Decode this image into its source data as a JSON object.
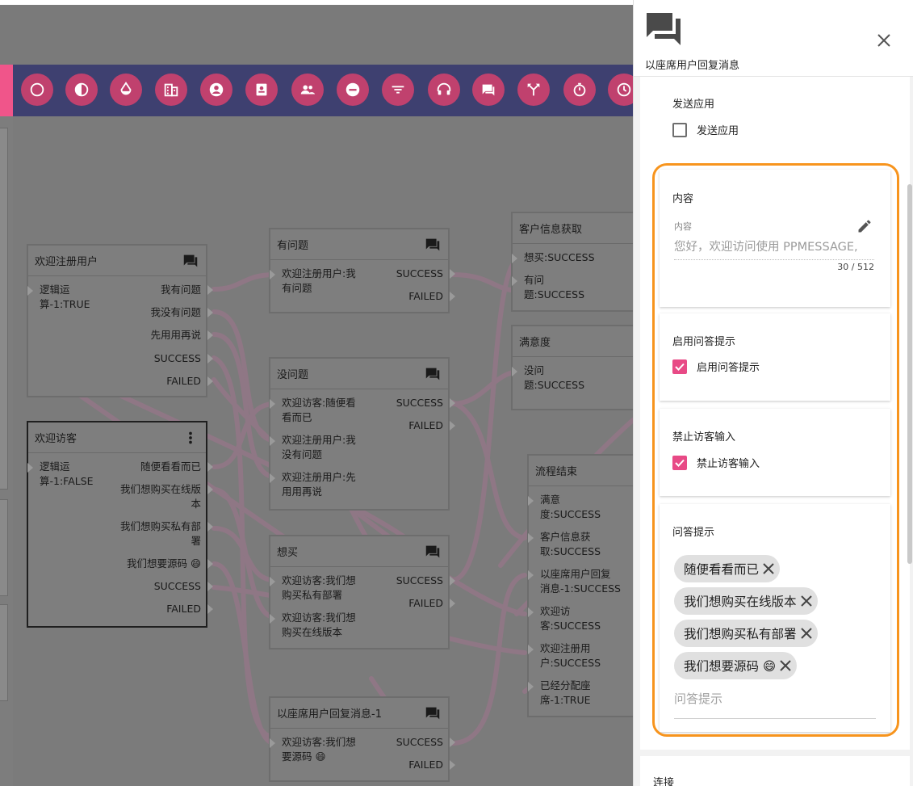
{
  "toolbar": {
    "icons": [
      "circle-icon",
      "contrast-icon",
      "drop-icon",
      "building-icon",
      "account-icon",
      "contacts-icon",
      "group-icon",
      "minus-circle-icon",
      "filter-icon",
      "headset-icon",
      "chat-icon",
      "split-icon",
      "timer-icon",
      "clock-icon"
    ]
  },
  "nodes": {
    "welcome_registered": {
      "title": "欢迎注册用户",
      "input": "逻辑运\n算-1:TRUE",
      "outputs": [
        "我有问题",
        "我没有问题",
        "先用用再说",
        "SUCCESS",
        "FAILED"
      ]
    },
    "welcome_visitor": {
      "title": "欢迎访客",
      "input": "逻辑运\n算-1:FALSE",
      "outputs": [
        "随便看看而已",
        "我们想购买在线版\n本",
        "我们想购买私有部\n署",
        "我们想要源码 😄",
        "SUCCESS",
        "FAILED"
      ]
    },
    "has_problem": {
      "title": "有问题",
      "inputs": [
        "欢迎注册用户:我\n有问题"
      ],
      "outputs": [
        "SUCCESS",
        "FAILED"
      ]
    },
    "no_problem": {
      "title": "没问题",
      "inputs": [
        "欢迎访客:随便看\n看而已",
        "欢迎注册用户:我\n没有问题",
        "欢迎注册用户:先\n用用再说"
      ],
      "outputs": [
        "SUCCESS",
        "FAILED"
      ]
    },
    "want_buy": {
      "title": "想买",
      "inputs": [
        "欢迎访客:我们想\n购买私有部署",
        "欢迎访客:我们想\n购买在线版本"
      ],
      "outputs": [
        "SUCCESS",
        "FAILED"
      ]
    },
    "agent_reply_1": {
      "title": "以座席用户回复消息-1",
      "inputs": [
        "欢迎访客:我们想\n要源码 😄"
      ],
      "outputs": [
        "SUCCESS",
        "FAILED"
      ]
    },
    "customer_info": {
      "title": "客户信息获取",
      "inputs": [
        "想买:SUCCESS",
        "有问\n题:SUCCESS"
      ]
    },
    "satisfaction": {
      "title": "满意度",
      "inputs": [
        "没问\n题:SUCCESS"
      ]
    },
    "flow_end": {
      "title": "流程结束",
      "inputs": [
        "满意\n度:SUCCESS",
        "客户信息获\n取:SUCCESS",
        "以座席用户回复\n消息-1:SUCCESS",
        "欢迎访\n客:SUCCESS",
        "欢迎注册用\n户:SUCCESS",
        "已经分配座\n席-1:TRUE"
      ]
    }
  },
  "panel": {
    "title": "以座席用户回复消息",
    "send_app": {
      "title": "发送应用",
      "checkbox_label": "发送应用",
      "checked": false
    },
    "content": {
      "title": "内容",
      "field_label": "内容",
      "field_value": "您好，欢迎访问使用 PPMESSAGE,",
      "counter": "30 / 512"
    },
    "qa_hint_enable": {
      "title": "启用问答提示",
      "checkbox_label": "启用问答提示",
      "checked": true
    },
    "disable_input": {
      "title": "禁止访客输入",
      "checkbox_label": "禁止访客输入",
      "checked": true
    },
    "qa_hints": {
      "title": "问答提示",
      "chips": [
        "随便看看而已",
        "我们想购买在线版本",
        "我们想购买私有部署",
        "我们想要源码 😄"
      ],
      "placeholder": "问答提示"
    },
    "connection": {
      "title": "连接"
    }
  },
  "colors": {
    "accent_pink": "#e84a86",
    "toolbar_bg": "#3e4070",
    "highlight_orange": "#f7941d"
  }
}
